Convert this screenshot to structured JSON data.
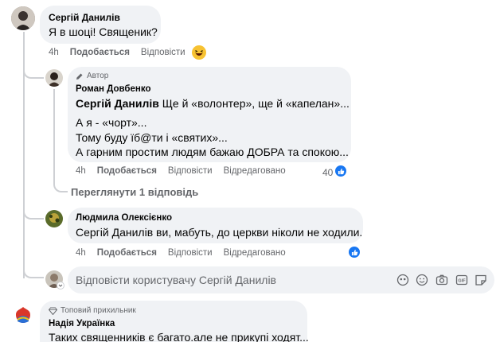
{
  "comment1": {
    "author": "Сергій Данилів",
    "text": "Я в шоці! Священик?",
    "time": "4h",
    "like": "Подобається",
    "reply": "Відповісти",
    "reaction_icon": "laughing-emoji"
  },
  "reply1": {
    "badge": "Автор",
    "badge_icon": "pencil-icon",
    "author": "Роман Довбенко",
    "mention": "Сергій Данилів",
    "line1": " Ще й «волонтер», ще й «капелан»...",
    "line2": "А я - «чорт»...",
    "line3": "Тому буду їб@ти і «святих»...",
    "line4": "А гарним простим людям бажаю ДОБРА та спокою...",
    "time": "4h",
    "like": "Подобається",
    "reply": "Відповісти",
    "edited": "Відредаговано",
    "likes": "40"
  },
  "view_replies": "Переглянути 1 відповідь",
  "reply2": {
    "author": "Людмила Олексієнко",
    "mention": "Сергій Данилів",
    "text": " ви, мабуть, до церкви ніколи не ходили.",
    "time": "4h",
    "like": "Подобається",
    "reply": "Відповісти",
    "edited": "Відредаговано"
  },
  "reply_input": {
    "placeholder": "Відповісти користувачу Сергій Данилів"
  },
  "comment2": {
    "badge": "Топовий прихильник",
    "badge_icon": "diamond-icon",
    "author": "Надія Українка",
    "text": "Таких священників є багато.але не прикупі ходят..."
  },
  "colors": {
    "bubble": "#f0f2f5",
    "secondary_text": "#65676b",
    "like_blue": "#1877f2"
  }
}
